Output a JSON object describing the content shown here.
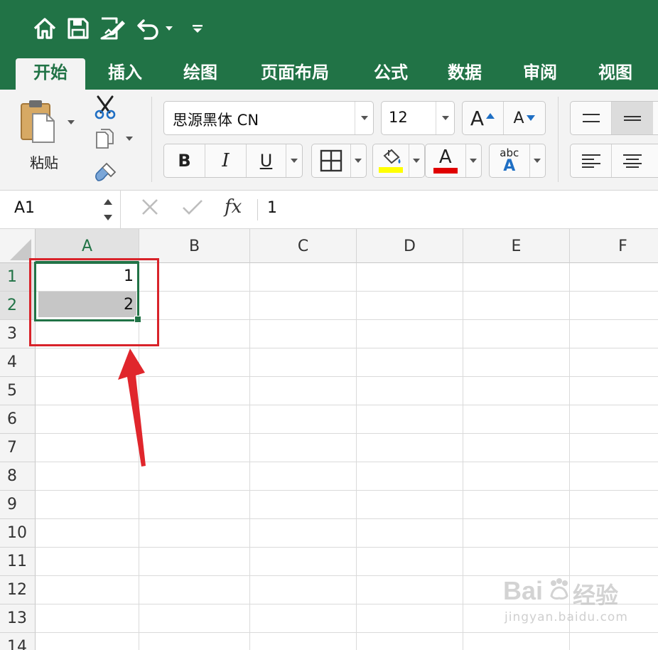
{
  "qat": {
    "icons": [
      "home-icon",
      "save-icon",
      "edit-doc-icon",
      "undo-icon",
      "chevron-down-icon",
      "customize-toolbar-icon"
    ]
  },
  "ribbon_tabs": [
    {
      "label": "开始",
      "active": true
    },
    {
      "label": "插入",
      "active": false
    },
    {
      "label": "绘图",
      "active": false
    },
    {
      "label": "页面布局",
      "active": false
    },
    {
      "label": "公式",
      "active": false
    },
    {
      "label": "数据",
      "active": false
    },
    {
      "label": "审阅",
      "active": false
    },
    {
      "label": "视图",
      "active": false
    }
  ],
  "clipboard": {
    "paste_label": "粘贴"
  },
  "font": {
    "name": "思源黑体 CN",
    "size": "12",
    "bold_label": "B",
    "italic_label": "I",
    "underline_label": "U",
    "grow_label": "A",
    "shrink_label": "A",
    "font_color_label": "A",
    "phonetic_small": "abc",
    "phonetic_big": "A",
    "fill_color": "#ffff00",
    "font_color": "#e00000"
  },
  "formula_bar": {
    "name_box": "A1",
    "fx_label": "fx",
    "value": "1"
  },
  "sheet": {
    "columns": [
      "A",
      "B",
      "C",
      "D",
      "E",
      "F"
    ],
    "rows": [
      "1",
      "2",
      "3",
      "4",
      "5",
      "6",
      "7",
      "8",
      "9",
      "10",
      "11",
      "12",
      "13",
      "14"
    ],
    "cells": {
      "A1": "1",
      "A2": "2"
    }
  },
  "watermark": {
    "brand": "Bai",
    "brand_suffix": "经验",
    "url": "jingyan.baidu.com"
  },
  "colors": {
    "accent": "#217346",
    "annotation": "#d8232a"
  }
}
